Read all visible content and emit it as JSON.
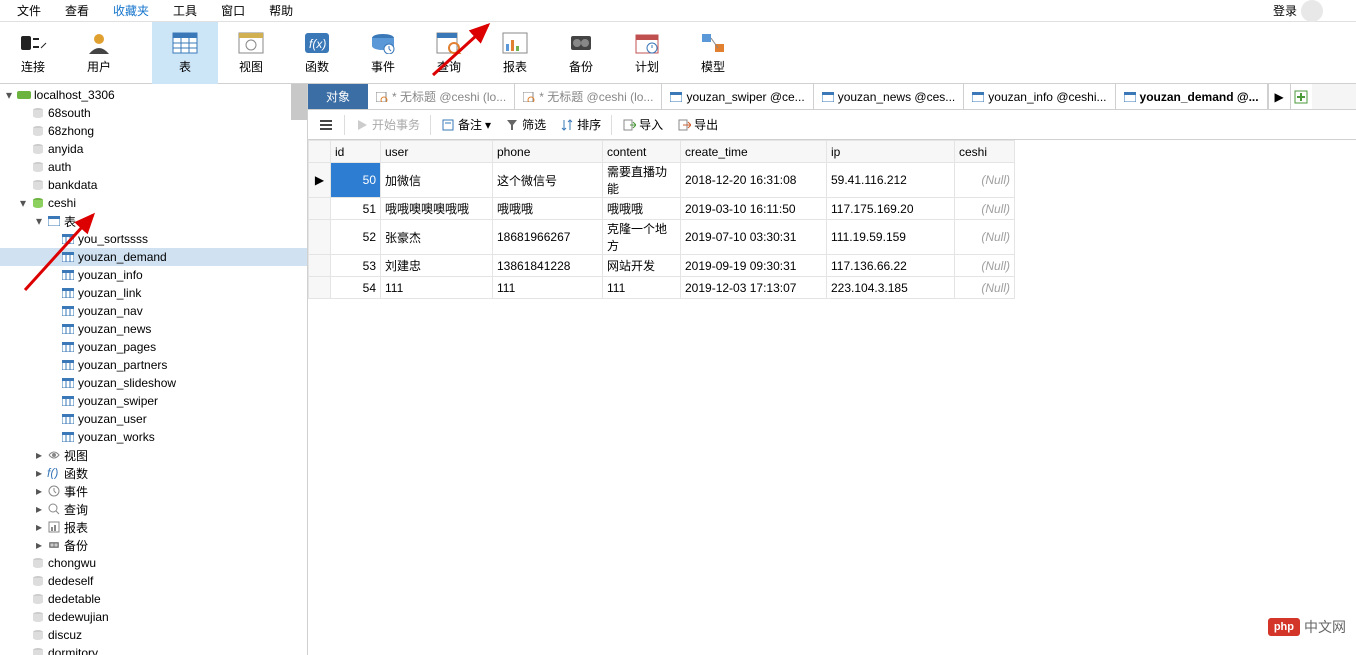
{
  "menu": {
    "file": "文件",
    "view": "查看",
    "fav": "收藏夹",
    "tools": "工具",
    "window": "窗口",
    "help": "帮助",
    "login": "登录"
  },
  "toolbar": {
    "connect": "连接",
    "user": "用户",
    "table": "表",
    "view": "视图",
    "func": "函数",
    "event": "事件",
    "query": "查询",
    "report": "报表",
    "backup": "备份",
    "plan": "计划",
    "model": "模型"
  },
  "tree": {
    "root": "localhost_3306",
    "dbs1": [
      "68south",
      "68zhong",
      "anyida",
      "auth",
      "bankdata"
    ],
    "open_db": "ceshi",
    "table_label": "表",
    "tables": [
      "you_sortssss",
      "youzan_demand",
      "youzan_info",
      "youzan_link",
      "youzan_nav",
      "youzan_news",
      "youzan_pages",
      "youzan_partners",
      "youzan_slideshow",
      "youzan_swiper",
      "youzan_user",
      "youzan_works"
    ],
    "selected_table_index": 1,
    "other_nodes": [
      {
        "icon": "view",
        "label": "视图"
      },
      {
        "icon": "fx",
        "label": "函数"
      },
      {
        "icon": "event",
        "label": "事件"
      },
      {
        "icon": "query",
        "label": "查询"
      },
      {
        "icon": "report",
        "label": "报表"
      },
      {
        "icon": "backup",
        "label": "备份"
      }
    ],
    "dbs2": [
      "chongwu",
      "dedeself",
      "dedetable",
      "dedewujian",
      "discuz",
      "dormitory"
    ]
  },
  "tabs": [
    {
      "name": "对象",
      "kind": "obj"
    },
    {
      "name": "* 无标题 @ceshi (lo...",
      "kind": "query",
      "grey": true
    },
    {
      "name": "* 无标题 @ceshi (lo...",
      "kind": "query",
      "grey": true
    },
    {
      "name": "youzan_swiper @ce...",
      "kind": "table"
    },
    {
      "name": "youzan_news @ces...",
      "kind": "table"
    },
    {
      "name": "youzan_info @ceshi...",
      "kind": "table"
    },
    {
      "name": "youzan_demand @...",
      "kind": "table",
      "active": true
    }
  ],
  "subtoolbar": {
    "begin": "开始事务",
    "note": "备注",
    "filter": "筛选",
    "sort": "排序",
    "import": "导入",
    "export": "导出"
  },
  "columns": [
    "id",
    "user",
    "phone",
    "content",
    "create_time",
    "ip",
    "ceshi"
  ],
  "rows": [
    {
      "id": 50,
      "user": "加微信",
      "phone": "这个微信号",
      "content": "需要直播功能",
      "create_time": "2018-12-20 16:31:08",
      "ip": "59.41.116.212",
      "ceshi": null,
      "current": true
    },
    {
      "id": 51,
      "user": "哦哦噢噢噢哦哦",
      "phone": "哦哦哦",
      "content": "哦哦哦",
      "create_time": "2019-03-10 16:11:50",
      "ip": "117.175.169.20",
      "ceshi": null
    },
    {
      "id": 52,
      "user": "张豪杰",
      "phone": "18681966267",
      "content": "克隆一个地方",
      "create_time": "2019-07-10 03:30:31",
      "ip": "111.19.59.159",
      "ceshi": null
    },
    {
      "id": 53,
      "user": "刘建忠",
      "phone": "13861841228",
      "content": "网站开发",
      "create_time": "2019-09-19 09:30:31",
      "ip": "117.136.66.22",
      "ceshi": null
    },
    {
      "id": 54,
      "user": "111",
      "phone": "111",
      "content": "111",
      "create_time": "2019-12-03 17:13:07",
      "ip": "223.104.3.185",
      "ceshi": null
    }
  ],
  "null_text": "(Null)",
  "watermark": {
    "badge": "php",
    "text": "中文网"
  }
}
